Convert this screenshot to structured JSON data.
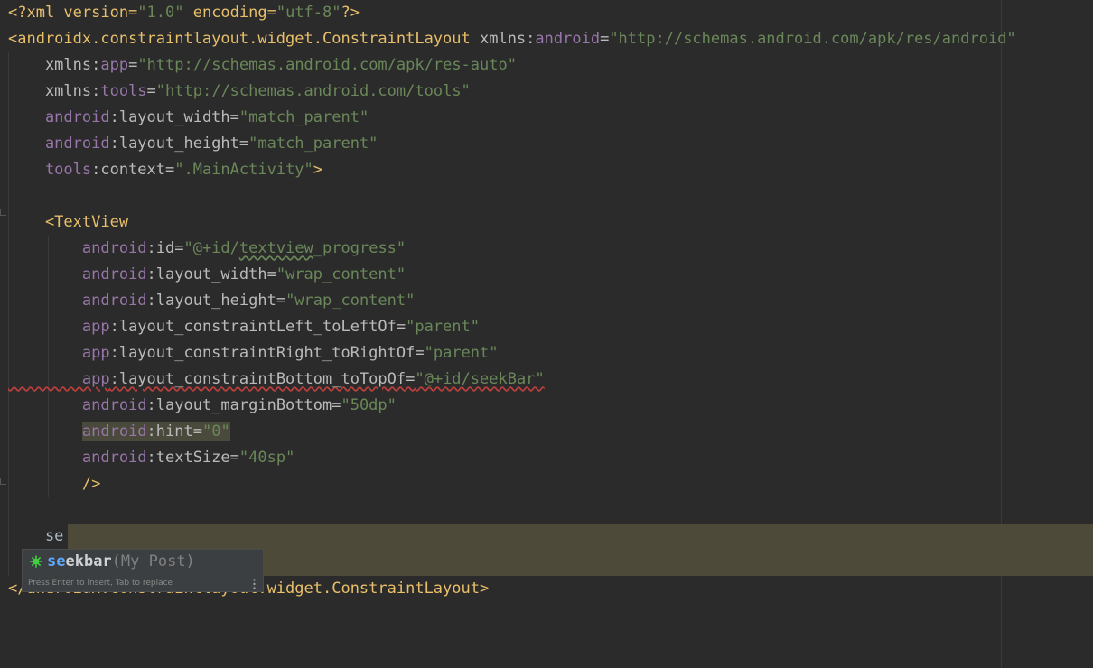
{
  "editor": {
    "lines": [
      [
        {
          "t": "<?xml version=",
          "c": "tag"
        },
        {
          "t": "\"1.0\"",
          "c": "val"
        },
        {
          "t": " encoding=",
          "c": "tag"
        },
        {
          "t": "\"utf-8\"",
          "c": "val"
        },
        {
          "t": "?>",
          "c": "tag"
        }
      ],
      [
        {
          "t": "<androidx.constraintlayout.widget.ConstraintLayout ",
          "c": "tag"
        },
        {
          "t": "xmlns:",
          "c": "attr"
        },
        {
          "t": "android",
          "c": "ns"
        },
        {
          "t": "=",
          "c": "attr"
        },
        {
          "t": "\"http://schemas.android.com/apk/res/android\"",
          "c": "val"
        }
      ],
      [
        {
          "t": "    xmlns:",
          "c": "attr"
        },
        {
          "t": "app",
          "c": "ns"
        },
        {
          "t": "=",
          "c": "attr"
        },
        {
          "t": "\"http://schemas.android.com/apk/res-auto\"",
          "c": "val"
        }
      ],
      [
        {
          "t": "    xmlns:",
          "c": "attr"
        },
        {
          "t": "tools",
          "c": "ns"
        },
        {
          "t": "=",
          "c": "attr"
        },
        {
          "t": "\"http://schemas.android.com/tools\"",
          "c": "val"
        }
      ],
      [
        {
          "t": "    android",
          "c": "ns"
        },
        {
          "t": ":layout_width=",
          "c": "attr"
        },
        {
          "t": "\"match_parent\"",
          "c": "val"
        }
      ],
      [
        {
          "t": "    android",
          "c": "ns"
        },
        {
          "t": ":layout_height=",
          "c": "attr"
        },
        {
          "t": "\"match_parent\"",
          "c": "val"
        }
      ],
      [
        {
          "t": "    tools",
          "c": "ns"
        },
        {
          "t": ":context=",
          "c": "attr"
        },
        {
          "t": "\".MainActivity\"",
          "c": "val"
        },
        {
          "t": ">",
          "c": "tag"
        }
      ],
      [],
      [
        {
          "t": "    <TextView",
          "c": "tag"
        }
      ],
      [
        {
          "t": "        android",
          "c": "ns"
        },
        {
          "t": ":id=",
          "c": "attr"
        },
        {
          "t": "\"@+id/",
          "c": "val"
        },
        {
          "t": "textview",
          "c": "val typo"
        },
        {
          "t": "_progress\"",
          "c": "val"
        }
      ],
      [
        {
          "t": "        android",
          "c": "ns"
        },
        {
          "t": ":layout_width=",
          "c": "attr"
        },
        {
          "t": "\"wrap_content\"",
          "c": "val"
        }
      ],
      [
        {
          "t": "        android",
          "c": "ns"
        },
        {
          "t": ":layout_height=",
          "c": "attr"
        },
        {
          "t": "\"wrap_content\"",
          "c": "val"
        }
      ],
      [
        {
          "t": "        app",
          "c": "ns"
        },
        {
          "t": ":layout_constraintLeft_toLeftOf=",
          "c": "attr"
        },
        {
          "t": "\"parent\"",
          "c": "val"
        }
      ],
      [
        {
          "t": "        app",
          "c": "ns"
        },
        {
          "t": ":layout_constraintRight_toRightOf=",
          "c": "attr"
        },
        {
          "t": "\"parent\"",
          "c": "val"
        }
      ],
      [
        {
          "t": "        app",
          "c": "ns warn"
        },
        {
          "t": ":layout_constraintBottom_toTopOf=",
          "c": "attr warn"
        },
        {
          "t": "\"@+id/seekBar\"",
          "c": "val warn"
        }
      ],
      [
        {
          "t": "        android",
          "c": "ns"
        },
        {
          "t": ":layout_marginBottom=",
          "c": "attr"
        },
        {
          "t": "\"50dp\"",
          "c": "val"
        }
      ],
      [
        {
          "t": "        ",
          "c": "plain"
        },
        {
          "t": "android",
          "c": "ns hl-token"
        },
        {
          "t": ":hint=",
          "c": "attr hl-token"
        },
        {
          "t": "\"0\"",
          "c": "val hl-token"
        }
      ],
      [
        {
          "t": "        android",
          "c": "ns"
        },
        {
          "t": ":textSize=",
          "c": "attr"
        },
        {
          "t": "\"40sp\"",
          "c": "val"
        }
      ],
      [
        {
          "t": "        />",
          "c": "tag"
        }
      ],
      [],
      [
        {
          "t": "    se",
          "c": "plain"
        }
      ],
      [],
      [
        {
          "t": "</androidx.constraintlayout.widget.ConstraintLayout>",
          "c": "tag"
        }
      ]
    ]
  },
  "autocomplete": {
    "match": "se",
    "rest": "ekbar",
    "detail": "(My Post)",
    "footer": "Press Enter to insert, Tab to replace",
    "icon": "live-template-icon",
    "icon_color": "#3fd13f"
  }
}
